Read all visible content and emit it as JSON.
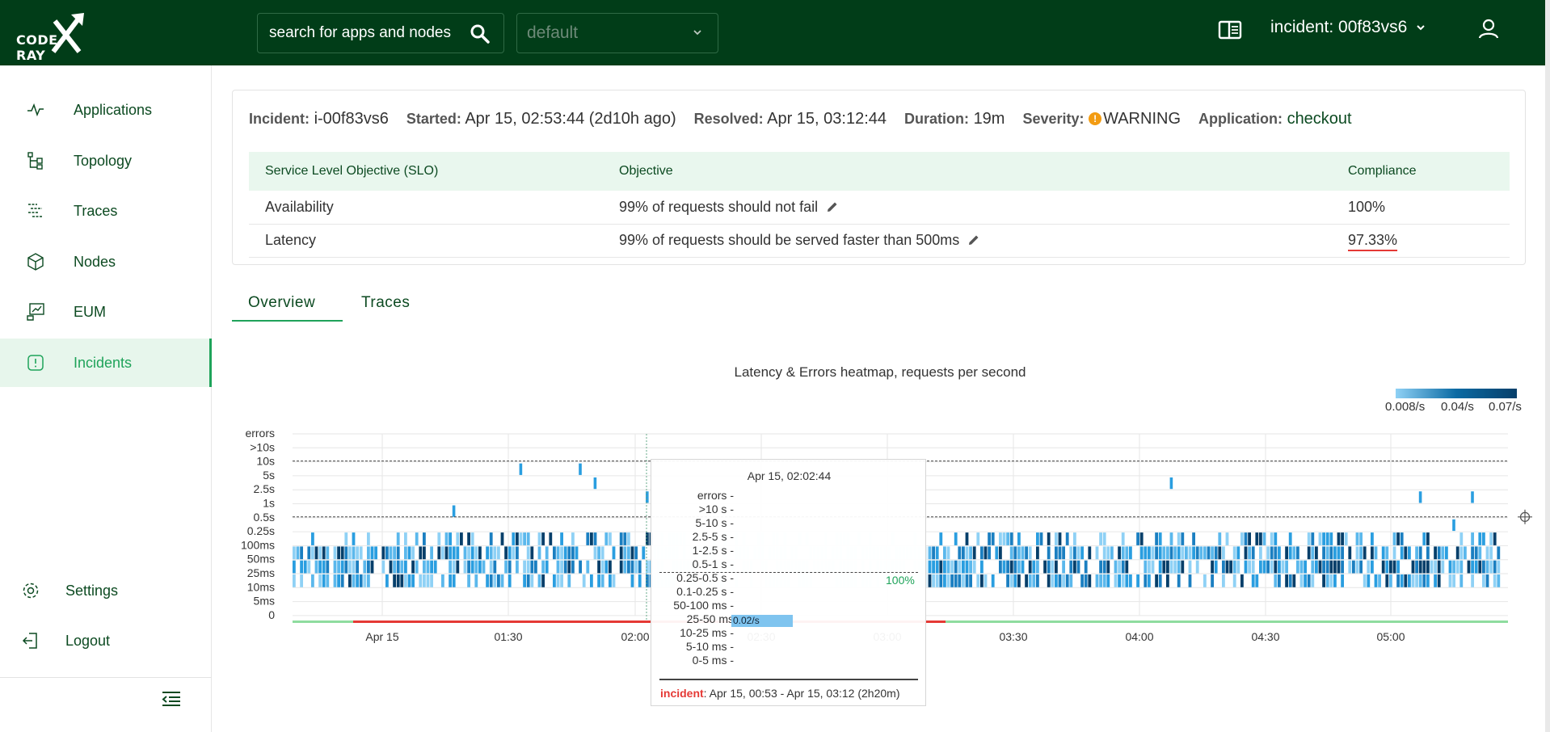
{
  "header": {
    "logo_text": "CODE",
    "logo_suffix": "RAY",
    "search_placeholder": "search for apps and nodes",
    "project": "default",
    "incident_selector": "incident: 00f83vs6"
  },
  "sidebar": {
    "items": [
      {
        "label": "Applications",
        "icon": "pulse-icon"
      },
      {
        "label": "Topology",
        "icon": "topology-icon"
      },
      {
        "label": "Traces",
        "icon": "traces-icon"
      },
      {
        "label": "Nodes",
        "icon": "cube-icon"
      },
      {
        "label": "EUM",
        "icon": "monitor-chart-icon"
      },
      {
        "label": "Incidents",
        "icon": "alert-square-icon",
        "active": true
      }
    ],
    "settings": "Settings",
    "logout": "Logout"
  },
  "incident": {
    "incident_label": "Incident:",
    "incident_value": "i-00f83vs6",
    "started_label": "Started:",
    "started_value": "Apr 15, 02:53:44 (2d10h ago)",
    "resolved_label": "Resolved:",
    "resolved_value": "Apr 15, 03:12:44",
    "duration_label": "Duration:",
    "duration_value": "19m",
    "severity_label": "Severity:",
    "severity_value": "WARNING",
    "application_label": "Application:",
    "application_value": "checkout"
  },
  "slo_table": {
    "headers": [
      "Service Level Objective (SLO)",
      "Objective",
      "Compliance"
    ],
    "rows": [
      {
        "name": "Availability",
        "objective": "99% of requests should not fail",
        "compliance": "100%"
      },
      {
        "name": "Latency",
        "objective": "99% of requests should be served faster than 500ms",
        "compliance": "97.33%"
      }
    ]
  },
  "tabs": [
    "Overview",
    "Traces"
  ],
  "chart_data": {
    "type": "heatmap",
    "title": "Latency & Errors heatmap, requests per second",
    "y_labels": [
      "errors",
      ">10s",
      "10s",
      "5s",
      "2.5s",
      "1s",
      "0.5s",
      "0.25s",
      "100ms",
      "50ms",
      "25ms",
      "10ms",
      "5ms",
      "0"
    ],
    "x_ticks": [
      "Apr 15",
      "01:30",
      "02:00",
      "02:30",
      "03:00",
      "03:30",
      "04:00",
      "04:30",
      "05:00"
    ],
    "legend": [
      "0.008/s",
      "0.04/s",
      "0.07/s"
    ],
    "colors": {
      "low": "#8fd1f5",
      "mid": "#2a9ee0",
      "high": "#063f6a",
      "ok": "#8fdc9f",
      "incident": "#e53935"
    },
    "slo_threshold": "0.5s",
    "incident_window": [
      "00:53",
      "03:12"
    ]
  },
  "tooltip": {
    "time": "Apr 15, 02:02:44",
    "rows": [
      "errors -",
      ">10 s -",
      "5-10 s -",
      "2.5-5 s -",
      "1-2.5 s -",
      "0.5-1 s -",
      "0.25-0.5 s -",
      "0.1-0.25 s -",
      "50-100 ms -",
      "25-50 ms",
      "10-25 ms -",
      "5-10 ms -",
      "0-5 ms -"
    ],
    "bar_value": "0.02/s",
    "percent": "100%",
    "incident_label": "incident",
    "incident_range": ": Apr 15, 00:53 - Apr 15, 03:12 (2h20m)"
  }
}
